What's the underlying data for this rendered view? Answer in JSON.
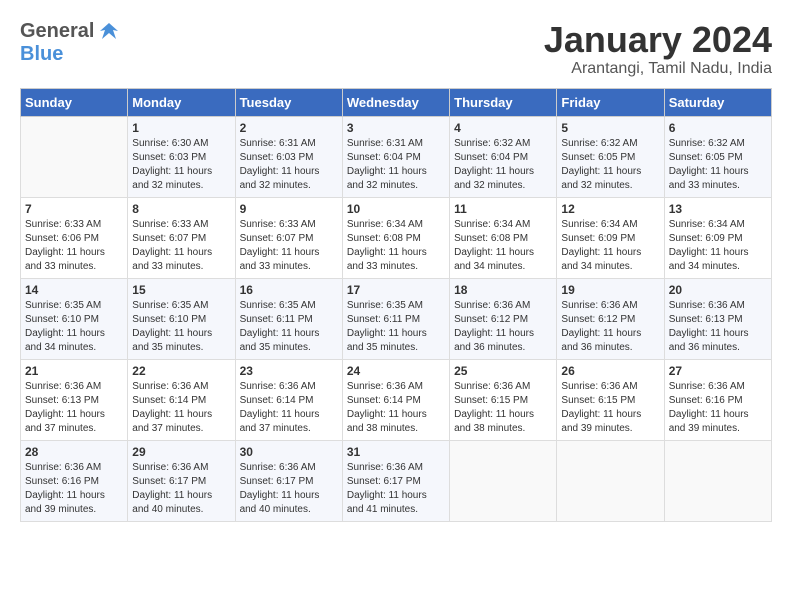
{
  "header": {
    "logo_line1": "General",
    "logo_line2": "Blue",
    "title": "January 2024",
    "subtitle": "Arantangi, Tamil Nadu, India"
  },
  "columns": [
    "Sunday",
    "Monday",
    "Tuesday",
    "Wednesday",
    "Thursday",
    "Friday",
    "Saturday"
  ],
  "weeks": [
    [
      {
        "day": "",
        "sunrise": "",
        "sunset": "",
        "daylight": ""
      },
      {
        "day": "1",
        "sunrise": "Sunrise: 6:30 AM",
        "sunset": "Sunset: 6:03 PM",
        "daylight": "Daylight: 11 hours and 32 minutes."
      },
      {
        "day": "2",
        "sunrise": "Sunrise: 6:31 AM",
        "sunset": "Sunset: 6:03 PM",
        "daylight": "Daylight: 11 hours and 32 minutes."
      },
      {
        "day": "3",
        "sunrise": "Sunrise: 6:31 AM",
        "sunset": "Sunset: 6:04 PM",
        "daylight": "Daylight: 11 hours and 32 minutes."
      },
      {
        "day": "4",
        "sunrise": "Sunrise: 6:32 AM",
        "sunset": "Sunset: 6:04 PM",
        "daylight": "Daylight: 11 hours and 32 minutes."
      },
      {
        "day": "5",
        "sunrise": "Sunrise: 6:32 AM",
        "sunset": "Sunset: 6:05 PM",
        "daylight": "Daylight: 11 hours and 32 minutes."
      },
      {
        "day": "6",
        "sunrise": "Sunrise: 6:32 AM",
        "sunset": "Sunset: 6:05 PM",
        "daylight": "Daylight: 11 hours and 33 minutes."
      }
    ],
    [
      {
        "day": "7",
        "sunrise": "Sunrise: 6:33 AM",
        "sunset": "Sunset: 6:06 PM",
        "daylight": "Daylight: 11 hours and 33 minutes."
      },
      {
        "day": "8",
        "sunrise": "Sunrise: 6:33 AM",
        "sunset": "Sunset: 6:07 PM",
        "daylight": "Daylight: 11 hours and 33 minutes."
      },
      {
        "day": "9",
        "sunrise": "Sunrise: 6:33 AM",
        "sunset": "Sunset: 6:07 PM",
        "daylight": "Daylight: 11 hours and 33 minutes."
      },
      {
        "day": "10",
        "sunrise": "Sunrise: 6:34 AM",
        "sunset": "Sunset: 6:08 PM",
        "daylight": "Daylight: 11 hours and 33 minutes."
      },
      {
        "day": "11",
        "sunrise": "Sunrise: 6:34 AM",
        "sunset": "Sunset: 6:08 PM",
        "daylight": "Daylight: 11 hours and 34 minutes."
      },
      {
        "day": "12",
        "sunrise": "Sunrise: 6:34 AM",
        "sunset": "Sunset: 6:09 PM",
        "daylight": "Daylight: 11 hours and 34 minutes."
      },
      {
        "day": "13",
        "sunrise": "Sunrise: 6:34 AM",
        "sunset": "Sunset: 6:09 PM",
        "daylight": "Daylight: 11 hours and 34 minutes."
      }
    ],
    [
      {
        "day": "14",
        "sunrise": "Sunrise: 6:35 AM",
        "sunset": "Sunset: 6:10 PM",
        "daylight": "Daylight: 11 hours and 34 minutes."
      },
      {
        "day": "15",
        "sunrise": "Sunrise: 6:35 AM",
        "sunset": "Sunset: 6:10 PM",
        "daylight": "Daylight: 11 hours and 35 minutes."
      },
      {
        "day": "16",
        "sunrise": "Sunrise: 6:35 AM",
        "sunset": "Sunset: 6:11 PM",
        "daylight": "Daylight: 11 hours and 35 minutes."
      },
      {
        "day": "17",
        "sunrise": "Sunrise: 6:35 AM",
        "sunset": "Sunset: 6:11 PM",
        "daylight": "Daylight: 11 hours and 35 minutes."
      },
      {
        "day": "18",
        "sunrise": "Sunrise: 6:36 AM",
        "sunset": "Sunset: 6:12 PM",
        "daylight": "Daylight: 11 hours and 36 minutes."
      },
      {
        "day": "19",
        "sunrise": "Sunrise: 6:36 AM",
        "sunset": "Sunset: 6:12 PM",
        "daylight": "Daylight: 11 hours and 36 minutes."
      },
      {
        "day": "20",
        "sunrise": "Sunrise: 6:36 AM",
        "sunset": "Sunset: 6:13 PM",
        "daylight": "Daylight: 11 hours and 36 minutes."
      }
    ],
    [
      {
        "day": "21",
        "sunrise": "Sunrise: 6:36 AM",
        "sunset": "Sunset: 6:13 PM",
        "daylight": "Daylight: 11 hours and 37 minutes."
      },
      {
        "day": "22",
        "sunrise": "Sunrise: 6:36 AM",
        "sunset": "Sunset: 6:14 PM",
        "daylight": "Daylight: 11 hours and 37 minutes."
      },
      {
        "day": "23",
        "sunrise": "Sunrise: 6:36 AM",
        "sunset": "Sunset: 6:14 PM",
        "daylight": "Daylight: 11 hours and 37 minutes."
      },
      {
        "day": "24",
        "sunrise": "Sunrise: 6:36 AM",
        "sunset": "Sunset: 6:14 PM",
        "daylight": "Daylight: 11 hours and 38 minutes."
      },
      {
        "day": "25",
        "sunrise": "Sunrise: 6:36 AM",
        "sunset": "Sunset: 6:15 PM",
        "daylight": "Daylight: 11 hours and 38 minutes."
      },
      {
        "day": "26",
        "sunrise": "Sunrise: 6:36 AM",
        "sunset": "Sunset: 6:15 PM",
        "daylight": "Daylight: 11 hours and 39 minutes."
      },
      {
        "day": "27",
        "sunrise": "Sunrise: 6:36 AM",
        "sunset": "Sunset: 6:16 PM",
        "daylight": "Daylight: 11 hours and 39 minutes."
      }
    ],
    [
      {
        "day": "28",
        "sunrise": "Sunrise: 6:36 AM",
        "sunset": "Sunset: 6:16 PM",
        "daylight": "Daylight: 11 hours and 39 minutes."
      },
      {
        "day": "29",
        "sunrise": "Sunrise: 6:36 AM",
        "sunset": "Sunset: 6:17 PM",
        "daylight": "Daylight: 11 hours and 40 minutes."
      },
      {
        "day": "30",
        "sunrise": "Sunrise: 6:36 AM",
        "sunset": "Sunset: 6:17 PM",
        "daylight": "Daylight: 11 hours and 40 minutes."
      },
      {
        "day": "31",
        "sunrise": "Sunrise: 6:36 AM",
        "sunset": "Sunset: 6:17 PM",
        "daylight": "Daylight: 11 hours and 41 minutes."
      },
      {
        "day": "",
        "sunrise": "",
        "sunset": "",
        "daylight": ""
      },
      {
        "day": "",
        "sunrise": "",
        "sunset": "",
        "daylight": ""
      },
      {
        "day": "",
        "sunrise": "",
        "sunset": "",
        "daylight": ""
      }
    ]
  ]
}
